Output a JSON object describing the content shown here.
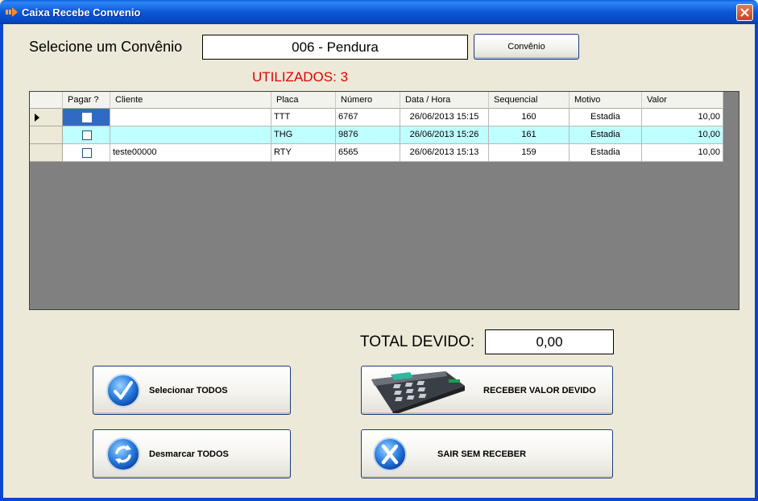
{
  "window": {
    "title": "Caixa Recebe Convenio"
  },
  "selector": {
    "label": "Selecione um Convênio",
    "value": "006 - Pendura",
    "button_label": "Convênio"
  },
  "utilizados": "UTILIZADOS: 3",
  "grid": {
    "columns": [
      "Pagar ?",
      "Cliente",
      "Placa",
      "Número",
      "Data / Hora",
      "Sequencial",
      "Motivo",
      "Valor"
    ],
    "rows": [
      {
        "cliente": "",
        "placa": "TTT",
        "numero": "6767",
        "data_hora": "26/06/2013 15:15",
        "sequencial": "160",
        "motivo": "Estadia",
        "valor": "10,00"
      },
      {
        "cliente": "",
        "placa": "THG",
        "numero": "9876",
        "data_hora": "26/06/2013 15:26",
        "sequencial": "161",
        "motivo": "Estadia",
        "valor": "10,00"
      },
      {
        "cliente": "teste00000",
        "placa": "RTY",
        "numero": "6565",
        "data_hora": "26/06/2013 15:13",
        "sequencial": "159",
        "motivo": "Estadia",
        "valor": "10,00"
      }
    ]
  },
  "total": {
    "label": "TOTAL DEVIDO:",
    "value": "0,00"
  },
  "buttons": {
    "select_all": "Selecionar TODOS",
    "deselect_all": "Desmarcar TODOS",
    "receive": "RECEBER VALOR DEVIDO",
    "exit": "SAIR SEM RECEBER"
  },
  "colors": {
    "title_bar": "#0A58D8",
    "utilizados": "#E00000",
    "row_highlight": "#BFFFFF",
    "selection": "#316AC5",
    "grid_background": "#808080"
  },
  "icons": {
    "title": "arrow-icon",
    "close": "close-icon",
    "select_all": "checkmark-icon",
    "deselect_all": "refresh-icon",
    "receive": "card-terminal-icon",
    "exit": "x-icon"
  }
}
